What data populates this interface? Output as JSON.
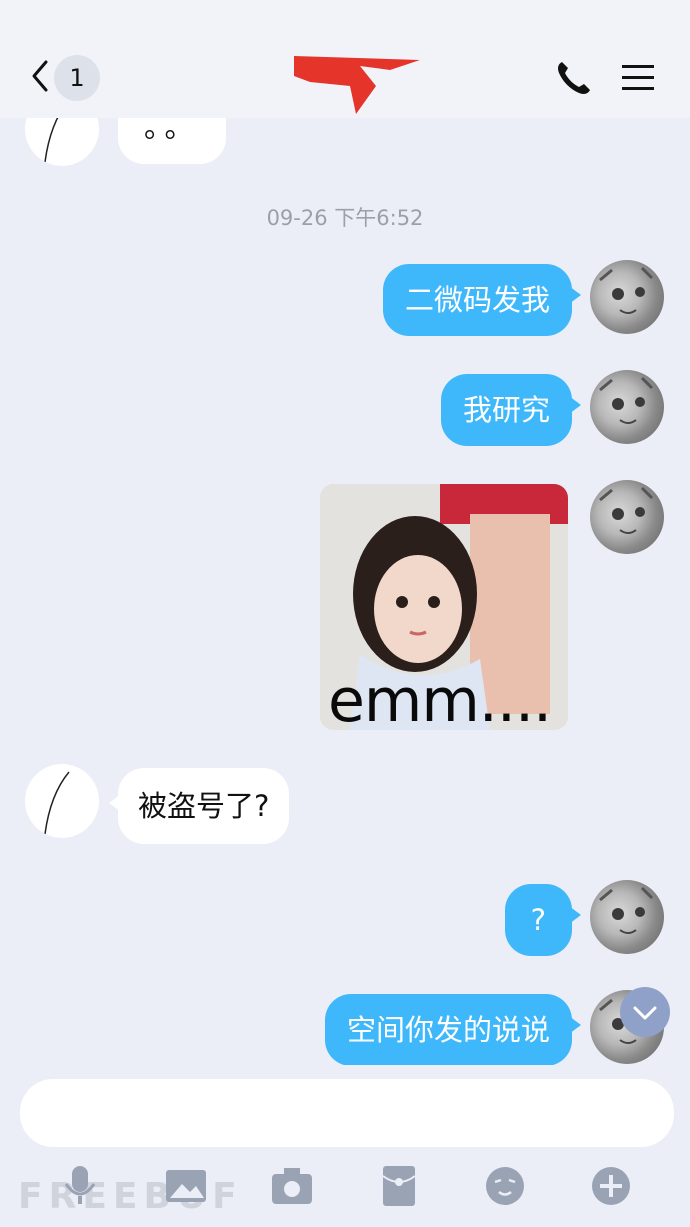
{
  "header": {
    "unread_count": "1",
    "title": "",
    "icons": {
      "back": "chevron-left-icon",
      "phone": "phone-icon",
      "menu": "menu-icon"
    }
  },
  "messages": {
    "peer_partial": "。。",
    "timestamp": "09-26 下午6:52",
    "out_1": "二微码发我",
    "out_2": "我研究",
    "image_caption": "emm....",
    "in_1": "被盗号了?",
    "out_3": "?",
    "out_4": "空间你发的说说"
  },
  "input": {
    "placeholder": ""
  },
  "toolbar": {
    "icons": [
      "microphone-icon",
      "photo-icon",
      "camera-icon",
      "red-packet-icon",
      "emoji-icon",
      "plus-icon"
    ]
  },
  "watermark": "FREEBUF",
  "colors": {
    "bubble_out": "#3fb8fb",
    "background": "#eceef7"
  }
}
